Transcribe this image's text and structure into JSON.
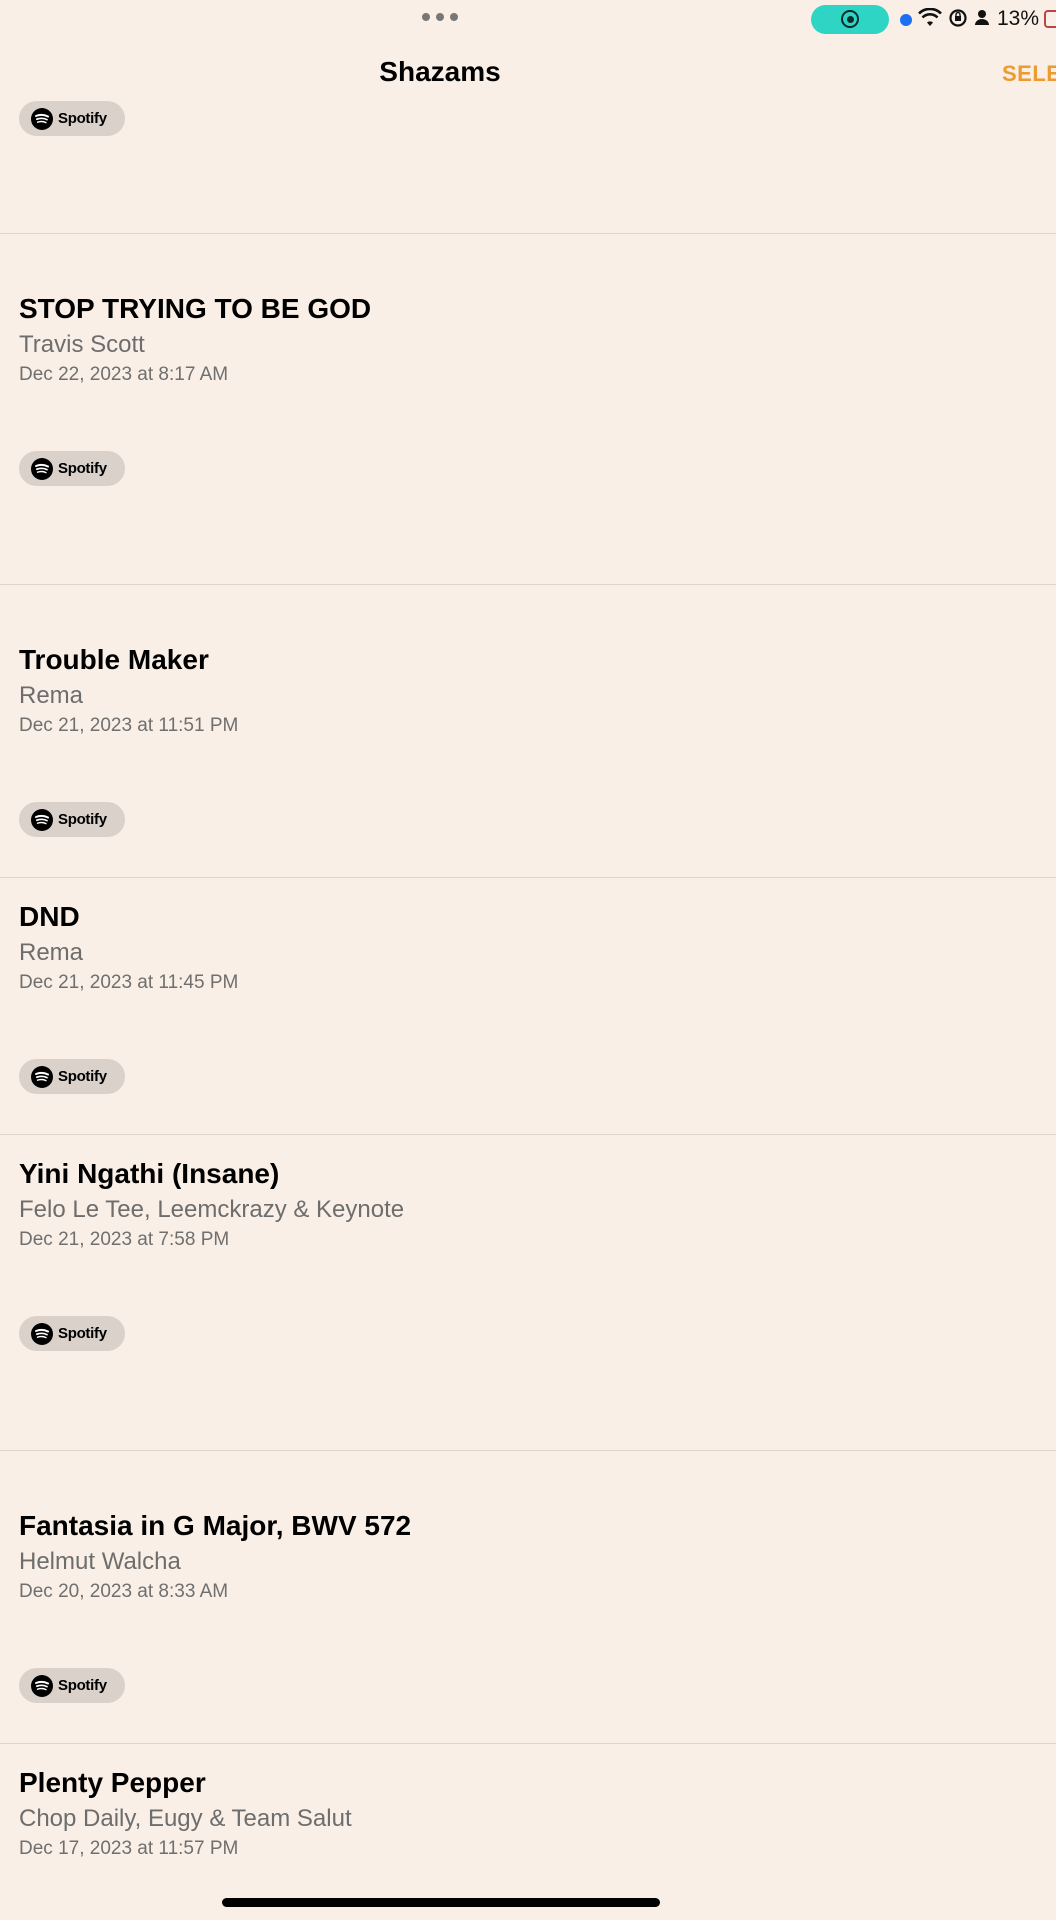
{
  "status_bar": {
    "battery_percent": "13%",
    "icons": [
      "more-dots-icon",
      "screen-record-icon",
      "wifi-icon",
      "orientation-lock-icon",
      "person-icon",
      "battery-icon"
    ],
    "record_color": "#2fd5c4"
  },
  "nav": {
    "title": "Shazams",
    "select_label": "SELE",
    "accent_color": "#ed9a2f"
  },
  "spotify_label": "Spotify",
  "songs": [
    {
      "title": "STOP TRYING TO BE GOD",
      "artist": "Travis Scott",
      "date": "Dec 22, 2023 at 8:17 AM"
    },
    {
      "title": "Trouble Maker",
      "artist": "Rema",
      "date": "Dec 21, 2023 at 11:51 PM"
    },
    {
      "title": "DND",
      "artist": "Rema",
      "date": "Dec 21, 2023 at 11:45 PM"
    },
    {
      "title": "Yini Ngathi (Insane)",
      "artist": "Felo Le Tee, Leemckrazy & Keynote",
      "date": "Dec 21, 2023 at 7:58 PM"
    },
    {
      "title": "Fantasia in G Major, BWV 572",
      "artist": "Helmut Walcha",
      "date": "Dec 20, 2023 at 8:33 AM"
    },
    {
      "title": "Plenty Pepper",
      "artist": "Chop Daily, Eugy & Team Salut",
      "date": "Dec 17, 2023 at 11:57 PM"
    }
  ]
}
